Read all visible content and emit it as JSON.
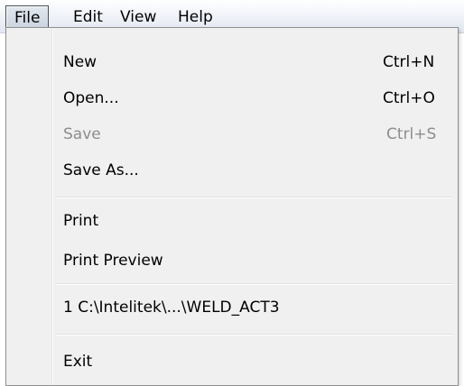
{
  "menubar": {
    "items": [
      {
        "label": "File"
      },
      {
        "label": "Edit"
      },
      {
        "label": "View"
      },
      {
        "label": "Help"
      }
    ]
  },
  "file_menu": {
    "new": {
      "label": "New",
      "shortcut": "Ctrl+N"
    },
    "open": {
      "label": "Open...",
      "shortcut": "Ctrl+O"
    },
    "save": {
      "label": "Save",
      "shortcut": "Ctrl+S",
      "enabled": false
    },
    "save_as": {
      "label": "Save As..."
    },
    "print": {
      "label": "Print"
    },
    "print_preview": {
      "label": "Print Preview"
    },
    "recent_file": {
      "label": "1 C:\\Intelitek\\...\\WELD_ACT3"
    },
    "exit": {
      "label": "Exit"
    }
  }
}
